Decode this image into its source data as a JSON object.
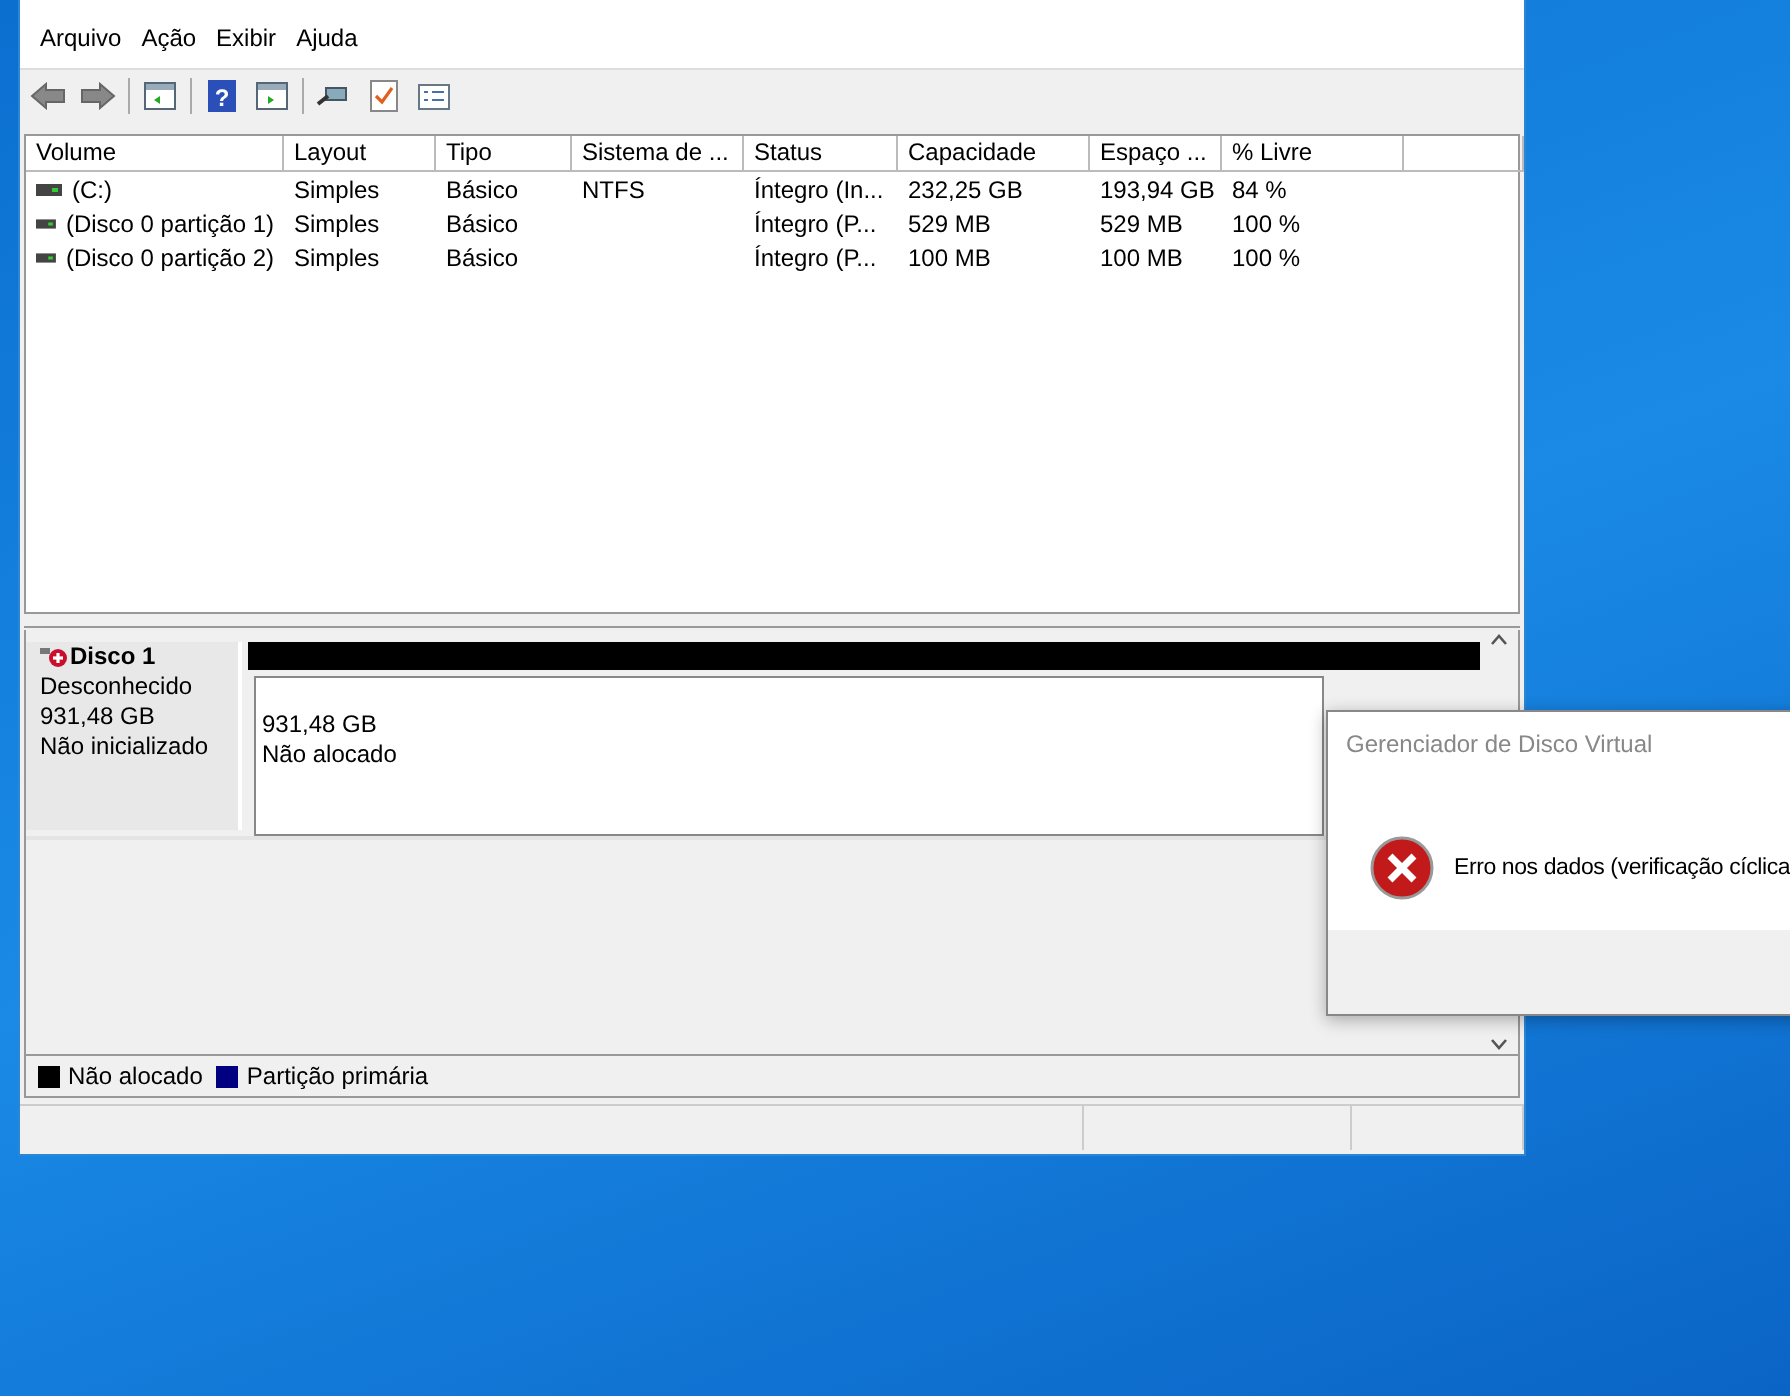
{
  "menu": [
    "Arquivo",
    "Ação",
    "Exibir",
    "Ajuda"
  ],
  "toolbar": {
    "help_glyph": "?"
  },
  "table": {
    "columns": [
      "Volume",
      "Layout",
      "Tipo",
      "Sistema de ...",
      "Status",
      "Capacidade",
      "Espaço ...",
      "% Livre"
    ],
    "rows": [
      {
        "cells": [
          "(C:)",
          "Simples",
          "Básico",
          "NTFS",
          "Íntegro (In...",
          "232,25 GB",
          "193,94 GB",
          "84 %"
        ]
      },
      {
        "cells": [
          "(Disco 0 partição 1)",
          "Simples",
          "Básico",
          "",
          "Íntegro (P...",
          "529 MB",
          "529 MB",
          "100 %"
        ]
      },
      {
        "cells": [
          "(Disco 0 partição 2)",
          "Simples",
          "Básico",
          "",
          "Íntegro (P...",
          "100 MB",
          "100 MB",
          "100 %"
        ]
      }
    ]
  },
  "disk": {
    "name": "Disco 1",
    "type": "Desconhecido",
    "size": "931,48 GB",
    "state": "Não inicializado",
    "partition": {
      "size": "931,48 GB",
      "label": "Não alocado"
    }
  },
  "legend": [
    {
      "label": "Não alocado",
      "color": "#000000"
    },
    {
      "label": "Partição primária",
      "color": "#000080"
    }
  ],
  "dialog": {
    "title": "Gerenciador de Disco Virtual",
    "message": "Erro nos dados (verificação cíclica"
  }
}
